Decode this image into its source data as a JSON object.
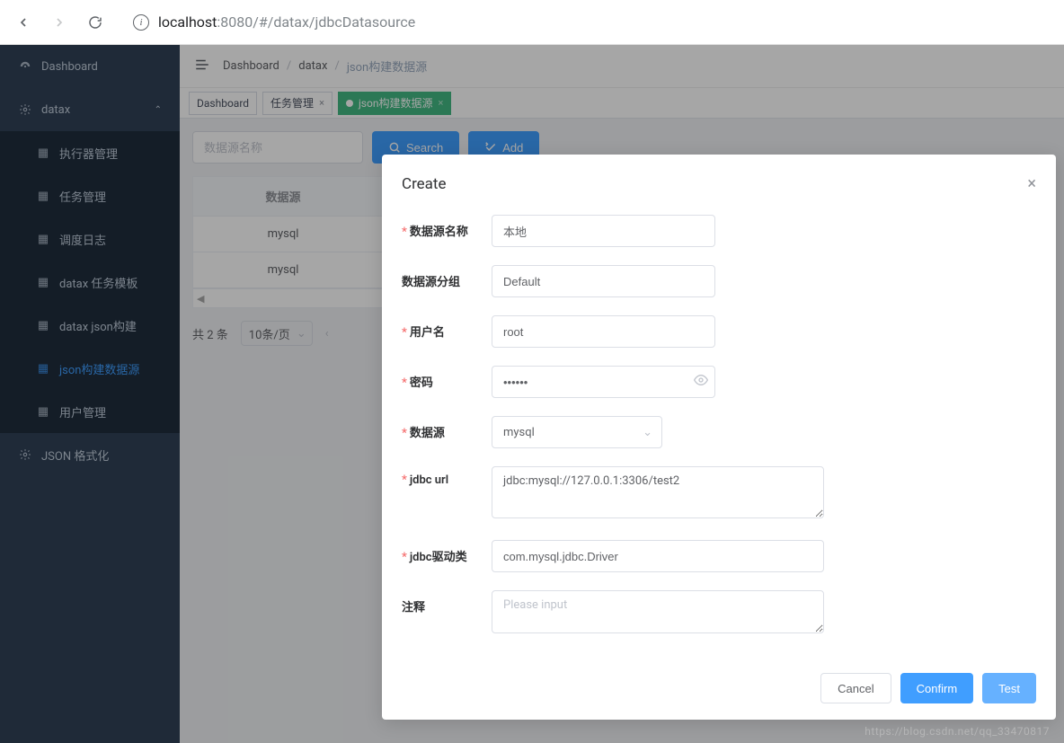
{
  "browser": {
    "url_host": "localhost",
    "url_rest": ":8080/#/datax/jdbcDatasource"
  },
  "sidebar": {
    "items": [
      {
        "label": "Dashboard"
      },
      {
        "label": "datax"
      },
      {
        "label": "执行器管理"
      },
      {
        "label": "任务管理"
      },
      {
        "label": "调度日志"
      },
      {
        "label": "datax 任务模板"
      },
      {
        "label": "datax json构建"
      },
      {
        "label": "json构建数据源"
      },
      {
        "label": "用户管理"
      },
      {
        "label": "JSON 格式化"
      }
    ]
  },
  "breadcrumb": {
    "items": [
      "Dashboard",
      "datax",
      "json构建数据源"
    ]
  },
  "tabs": [
    {
      "label": "Dashboard",
      "active": false,
      "closable": false
    },
    {
      "label": "任务管理",
      "active": false,
      "closable": true
    },
    {
      "label": "json构建数据源",
      "active": true,
      "closable": true
    }
  ],
  "toolbar": {
    "search_placeholder": "数据源名称",
    "search_btn": "Search",
    "add_btn": "Add"
  },
  "table": {
    "headers": [
      "数据源"
    ],
    "rows": [
      [
        "mysql"
      ],
      [
        "mysql"
      ]
    ]
  },
  "pagination": {
    "total_label": "共 2 条",
    "page_size_label": "10条/页"
  },
  "modal": {
    "title": "Create",
    "labels": {
      "name": "数据源名称",
      "group": "数据源分组",
      "username": "用户名",
      "password": "密码",
      "datasource": "数据源",
      "jdbc_url": "jdbc url",
      "jdbc_driver": "jdbc驱动类",
      "comment": "注释"
    },
    "values": {
      "name": "本地",
      "group": "Default",
      "username": "root",
      "password": "••••••",
      "datasource": "mysql",
      "jdbc_url": "jdbc:mysql://127.0.0.1:3306/test2",
      "jdbc_driver": "com.mysql.jdbc.Driver",
      "comment_placeholder": "Please input"
    },
    "buttons": {
      "cancel": "Cancel",
      "confirm": "Confirm",
      "test": "Test"
    }
  },
  "watermark": "https://blog.csdn.net/qq_33470817"
}
